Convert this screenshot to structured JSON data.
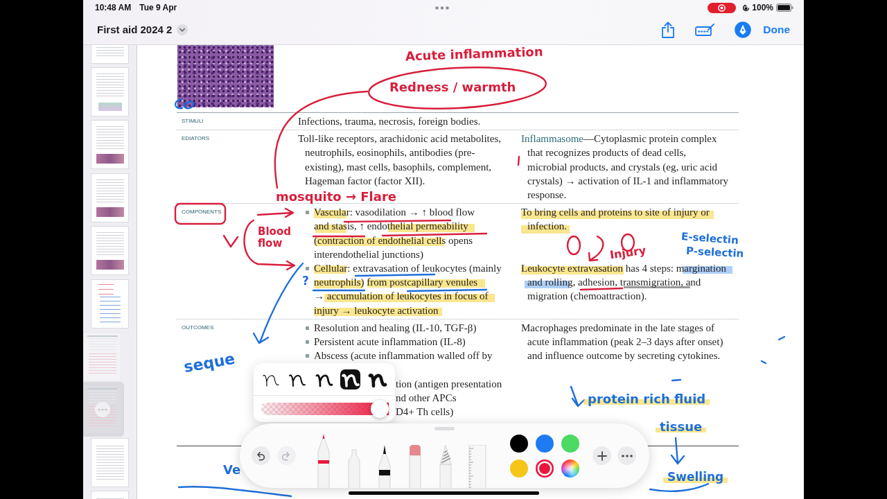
{
  "status_bar": {
    "time": "10:48 AM",
    "date": "Tue 9 Apr",
    "battery": "100%"
  },
  "header": {
    "title": "First aid 2024 2",
    "markup_selected": true,
    "done": "Done"
  },
  "thumbnails": [
    {
      "selected": false
    },
    {
      "selected": false
    },
    {
      "selected": false
    },
    {
      "selected": false
    },
    {
      "selected": false
    },
    {
      "selected": false
    },
    {
      "selected": false
    },
    {
      "selected": true
    },
    {
      "selected": false
    },
    {
      "selected": false
    }
  ],
  "page": {
    "rows": [
      {
        "label": "STIMULI",
        "groups": [
          {
            "column_2": [
              {
                "kind": "text",
                "text": "Infections, trauma, necrosis, foreign bodies."
              }
            ]
          }
        ]
      },
      {
        "label": "EDIATORS",
        "groups": [
          {
            "column_2": [
              {
                "kind": "text",
                "text": "Toll-like receptors, arachidonic acid metabolites,\nneutrophils, eosinophils, antibodies (pre-\nexisting), mast cells, basophils, complement,\nHageman factor (factor XII)."
              }
            ],
            "column_3": [
              {
                "kind": "text",
                "term": "Inflammasome",
                "text": "—Cytoplasmic protein complex\nthat recognizes products of dead cells,\nmicrobial products, and crystals (eg, uric acid\ncrystals) → activation of IL-1 and inflammatory\nresponse."
              }
            ]
          }
        ]
      },
      {
        "label": "COMPONENTS",
        "groups": [
          {
            "column_2": [
              {
                "kind": "bullet",
                "text": "Vascular: vasodilation → ↑ blood flow\nand stasis, ↑ endothelial permeability\n(contraction of endothelial cells opens\ninterendothelial junctions)"
              }
            ],
            "column_3": [
              {
                "kind": "text",
                "text": "To bring cells and proteins to site of injury or\ninfection."
              }
            ]
          },
          {
            "column_2": [
              {
                "kind": "bullet",
                "text": "Cellular: extravasation of leukocytes (mainly\nneutrophils) from postcapillary venules\n→ accumulation of leukocytes in focus of\ninjury → leukocyte activation"
              }
            ],
            "column_3": [
              {
                "kind": "text",
                "text": "Leukocyte extravasation has 4 steps: margination\nand rolling, adhesion, transmigration, and\nmigration (chemoattraction)."
              }
            ]
          }
        ]
      },
      {
        "label": "OUTCOMES",
        "groups": [
          {
            "column_2": [
              {
                "kind": "bullet",
                "text": "Resolution and healing (IL-10, TGF-β)"
              },
              {
                "kind": "bullet",
                "text": "Persistent acute inflammation (IL-8)"
              },
              {
                "kind": "bullet",
                "text": "Abscess (acute inflammation walled off by"
              },
              {
                "kind": "fragment",
                "text": "tion (antigen presentation\nnd other APCs\nD4+ Th cells)"
              }
            ],
            "column_3": [
              {
                "kind": "text",
                "text": "Macrophages predominate in the late stages of\nacute inflammation (peak 2–3 days after onset)\nand influence outcome by secreting cytokines."
              }
            ]
          }
        ]
      }
    ]
  },
  "handwritten_notes": [
    {
      "text": "Acute inflammation",
      "color": "#d81e3c"
    },
    {
      "text": "Redness / warmth",
      "color": "#d81e3c"
    },
    {
      "text": "mosquito → Flare",
      "color": "#d81e3c"
    },
    {
      "text": "Blood\nflow",
      "color": "#d81e3c"
    },
    {
      "text": "Injury",
      "color": "#d81e3c"
    },
    {
      "text": "E-selectin",
      "color": "#1e6fd9"
    },
    {
      "text": "P-selectin",
      "color": "#1e6fd9"
    },
    {
      "text": "?",
      "color": "#1e6fd9"
    },
    {
      "text": "seque",
      "color": "#1e6fd9"
    },
    {
      "text": "protein rich fluid",
      "color": "#1e6fd9"
    },
    {
      "text": "tissue",
      "color": "#1e6fd9"
    },
    {
      "text": "Swelling",
      "color": "#1e6fd9"
    },
    {
      "text": "Ve",
      "color": "#1e6fd9"
    }
  ],
  "pen_popup": {
    "weights": [
      {
        "selected": false
      },
      {
        "selected": false
      },
      {
        "selected": false
      },
      {
        "selected": true
      },
      {
        "selected": false
      }
    ],
    "opacity": {
      "level": 1
    }
  },
  "tool_palette": {
    "undo": {
      "disabled": false
    },
    "redo": {
      "disabled": true
    },
    "tools": [
      {
        "kind": "pen",
        "selected": true
      },
      {
        "kind": "monoline",
        "selected": false
      },
      {
        "kind": "fountain_pen",
        "selected": false
      },
      {
        "kind": "eraser",
        "selected": false
      },
      {
        "kind": "pencil",
        "selected": false
      },
      {
        "kind": "ruler",
        "selected": false
      }
    ],
    "colors": [
      {
        "kind": "swatch",
        "color": "#000000",
        "selected": false
      },
      {
        "kind": "swatch",
        "color": "#1f7bf2",
        "selected": false
      },
      {
        "kind": "swatch",
        "color": "#4cd964",
        "selected": false
      },
      {
        "kind": "swatch",
        "color": "#f5c518",
        "selected": false
      },
      {
        "kind": "swatch",
        "color": "#e8173c",
        "selected": true
      },
      {
        "kind": "wheel",
        "selected": false
      }
    ]
  }
}
